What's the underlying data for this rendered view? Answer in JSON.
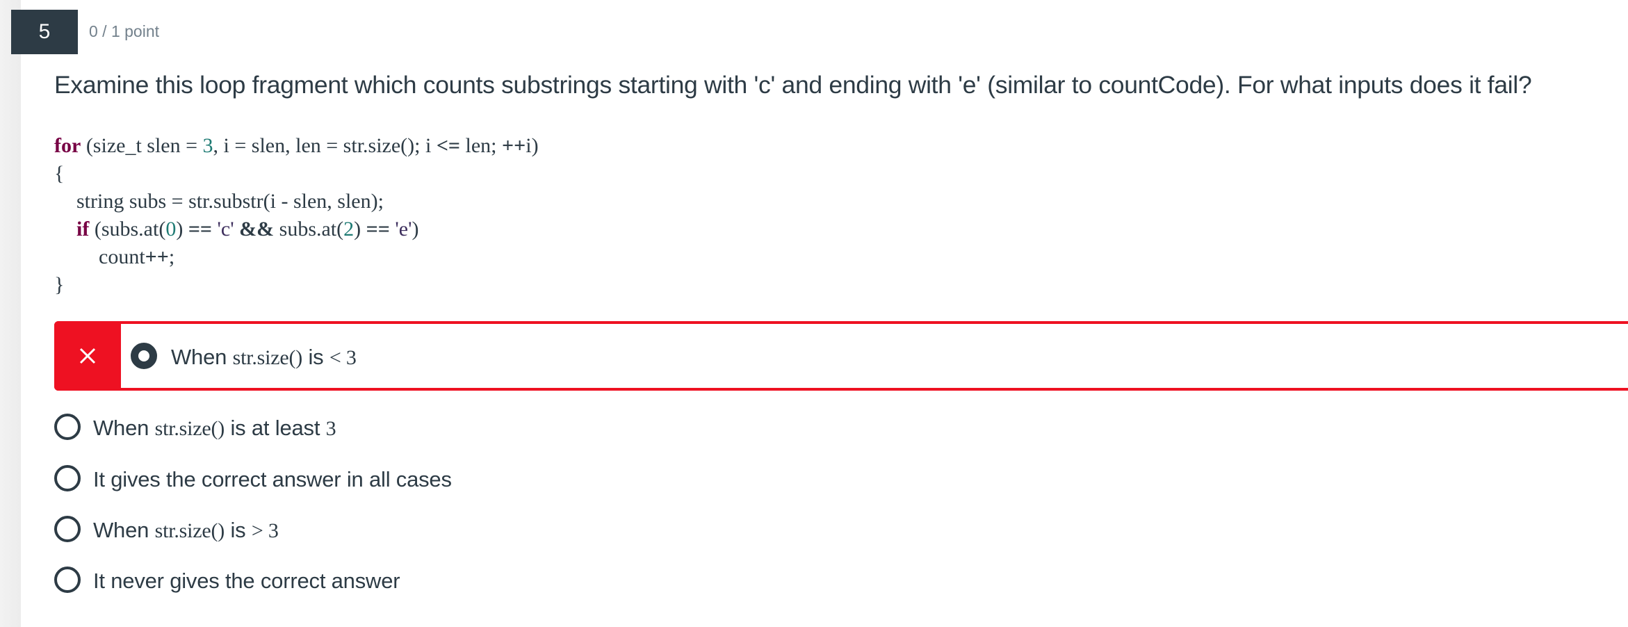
{
  "question": {
    "number": "5",
    "points": "0 / 1 point",
    "text": "Examine this loop fragment which counts substrings starting with 'c' and ending with 'e' (similar to countCode). For what inputs does it fail?"
  },
  "code": {
    "line1": {
      "kw": "for",
      "a": " (size_t slen = ",
      "num": "3",
      "b": ", i = slen, len = str.size(); i ",
      "op1": "<=",
      "c": " len; ",
      "op2": "++",
      "d": "i)"
    },
    "line2": "{",
    "line3": "string subs = str.substr(i - slen, slen);",
    "line4": {
      "kw": "if",
      "a": " (subs.at(",
      "n0": "0",
      "b": ") ",
      "eq1": "==",
      "s1": " 'c' ",
      "and": "&&",
      "c": " subs.at(",
      "n2": "2",
      "d": ") ",
      "eq2": "==",
      "s2": " 'e'",
      "e": ")"
    },
    "line5": {
      "a": "count",
      "op": "++",
      "b": ";"
    },
    "line6": "}"
  },
  "answers": [
    {
      "pre": "When ",
      "code": "str.size()",
      "mid": " is ",
      "code2": "< 3",
      "selected": true,
      "result": "incorrect"
    },
    {
      "pre": "When ",
      "code": "str.size()",
      "mid": " is at least ",
      "code2": "3",
      "selected": false
    },
    {
      "pre": "It gives the correct answer in all cases",
      "selected": false
    },
    {
      "pre": "When ",
      "code": "str.size()",
      "mid": " is ",
      "code2": "> 3",
      "selected": false
    },
    {
      "pre": "It never gives the correct answer",
      "selected": false
    }
  ],
  "colors": {
    "incorrect": "#ee1122",
    "badge": "#2d3b45",
    "keyword": "#770044",
    "number": "#1f7b74"
  },
  "icons": {
    "incorrect": "close-x-icon",
    "radio": "radio-icon"
  }
}
